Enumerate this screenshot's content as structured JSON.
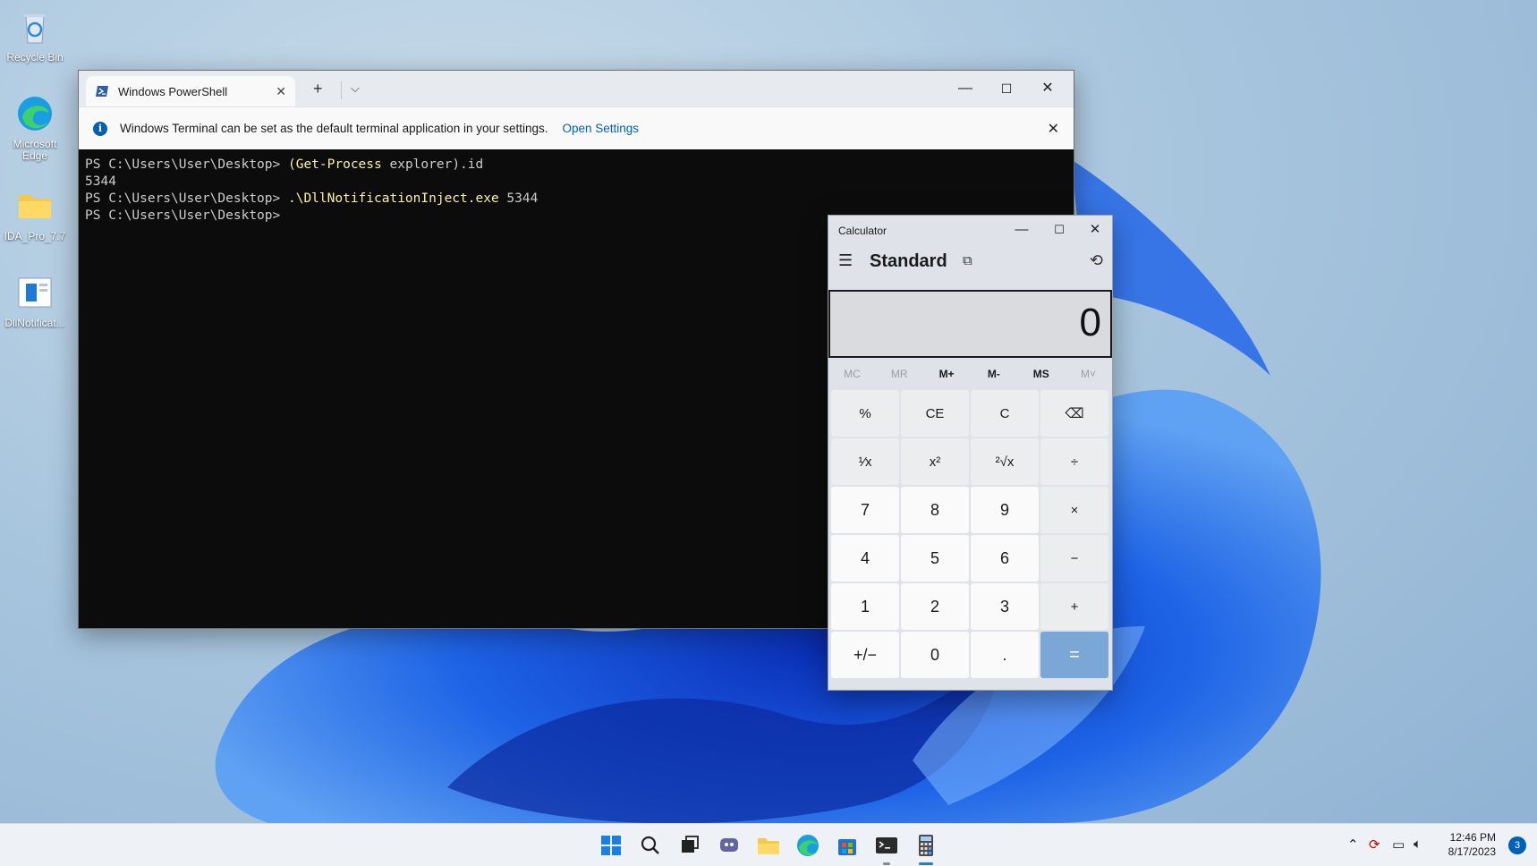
{
  "desktop": {
    "icons": [
      {
        "label": "Recycle Bin",
        "icon": "recycle-bin-icon"
      },
      {
        "label": "Microsoft Edge",
        "icon": "edge-icon"
      },
      {
        "label": "IDA_Pro_7.7",
        "icon": "folder-icon"
      },
      {
        "label": "DllNotificat...",
        "icon": "exe-icon"
      }
    ]
  },
  "terminal": {
    "tab_title": "Windows PowerShell",
    "info_text": "Windows Terminal can be set as the default terminal application in your settings.",
    "info_link": "Open Settings",
    "lines": [
      {
        "prompt": "PS C:\\Users\\User\\Desktop> ",
        "cmd": "(Get-Process",
        "rest": " explorer).id"
      },
      {
        "prompt": "5344",
        "cmd": "",
        "rest": ""
      },
      {
        "prompt": "PS C:\\Users\\User\\Desktop> ",
        "cmd": ".\\DllNotificationInject.exe",
        "rest": " 5344"
      },
      {
        "prompt": "PS C:\\Users\\User\\Desktop> ",
        "cmd": "",
        "rest": ""
      }
    ]
  },
  "calculator": {
    "window_title": "Calculator",
    "mode": "Standard",
    "display": "0",
    "memory": [
      {
        "label": "MC",
        "enabled": false
      },
      {
        "label": "MR",
        "enabled": false
      },
      {
        "label": "M+",
        "enabled": true
      },
      {
        "label": "M-",
        "enabled": true
      },
      {
        "label": "MS",
        "enabled": true
      },
      {
        "label": "M˅",
        "enabled": false
      }
    ],
    "keys": [
      {
        "label": "%",
        "type": "op"
      },
      {
        "label": "CE",
        "type": "op"
      },
      {
        "label": "C",
        "type": "op"
      },
      {
        "label": "⌫",
        "type": "op"
      },
      {
        "label": "¹⁄x",
        "type": "op"
      },
      {
        "label": "x²",
        "type": "op"
      },
      {
        "label": "²√x",
        "type": "op"
      },
      {
        "label": "÷",
        "type": "op"
      },
      {
        "label": "7",
        "type": "num"
      },
      {
        "label": "8",
        "type": "num"
      },
      {
        "label": "9",
        "type": "num"
      },
      {
        "label": "×",
        "type": "op"
      },
      {
        "label": "4",
        "type": "num"
      },
      {
        "label": "5",
        "type": "num"
      },
      {
        "label": "6",
        "type": "num"
      },
      {
        "label": "−",
        "type": "op"
      },
      {
        "label": "1",
        "type": "num"
      },
      {
        "label": "2",
        "type": "num"
      },
      {
        "label": "3",
        "type": "num"
      },
      {
        "label": "+",
        "type": "op"
      },
      {
        "label": "+/−",
        "type": "num"
      },
      {
        "label": "0",
        "type": "num"
      },
      {
        "label": ".",
        "type": "num"
      },
      {
        "label": "=",
        "type": "eq"
      }
    ]
  },
  "taskbar": {
    "clock_time": "12:46 PM",
    "clock_date": "8/17/2023",
    "notification_count": "3",
    "apps": [
      "start-icon",
      "search-icon",
      "task-view-icon",
      "chat-icon",
      "file-explorer-icon",
      "edge-icon",
      "store-icon",
      "terminal-icon",
      "calculator-icon"
    ]
  },
  "colors": {
    "accent": "#005fb8",
    "equals_key": "#7aa7d6",
    "terminal_bg": "#0c0c0c",
    "command_text": "#f9f1a5"
  }
}
